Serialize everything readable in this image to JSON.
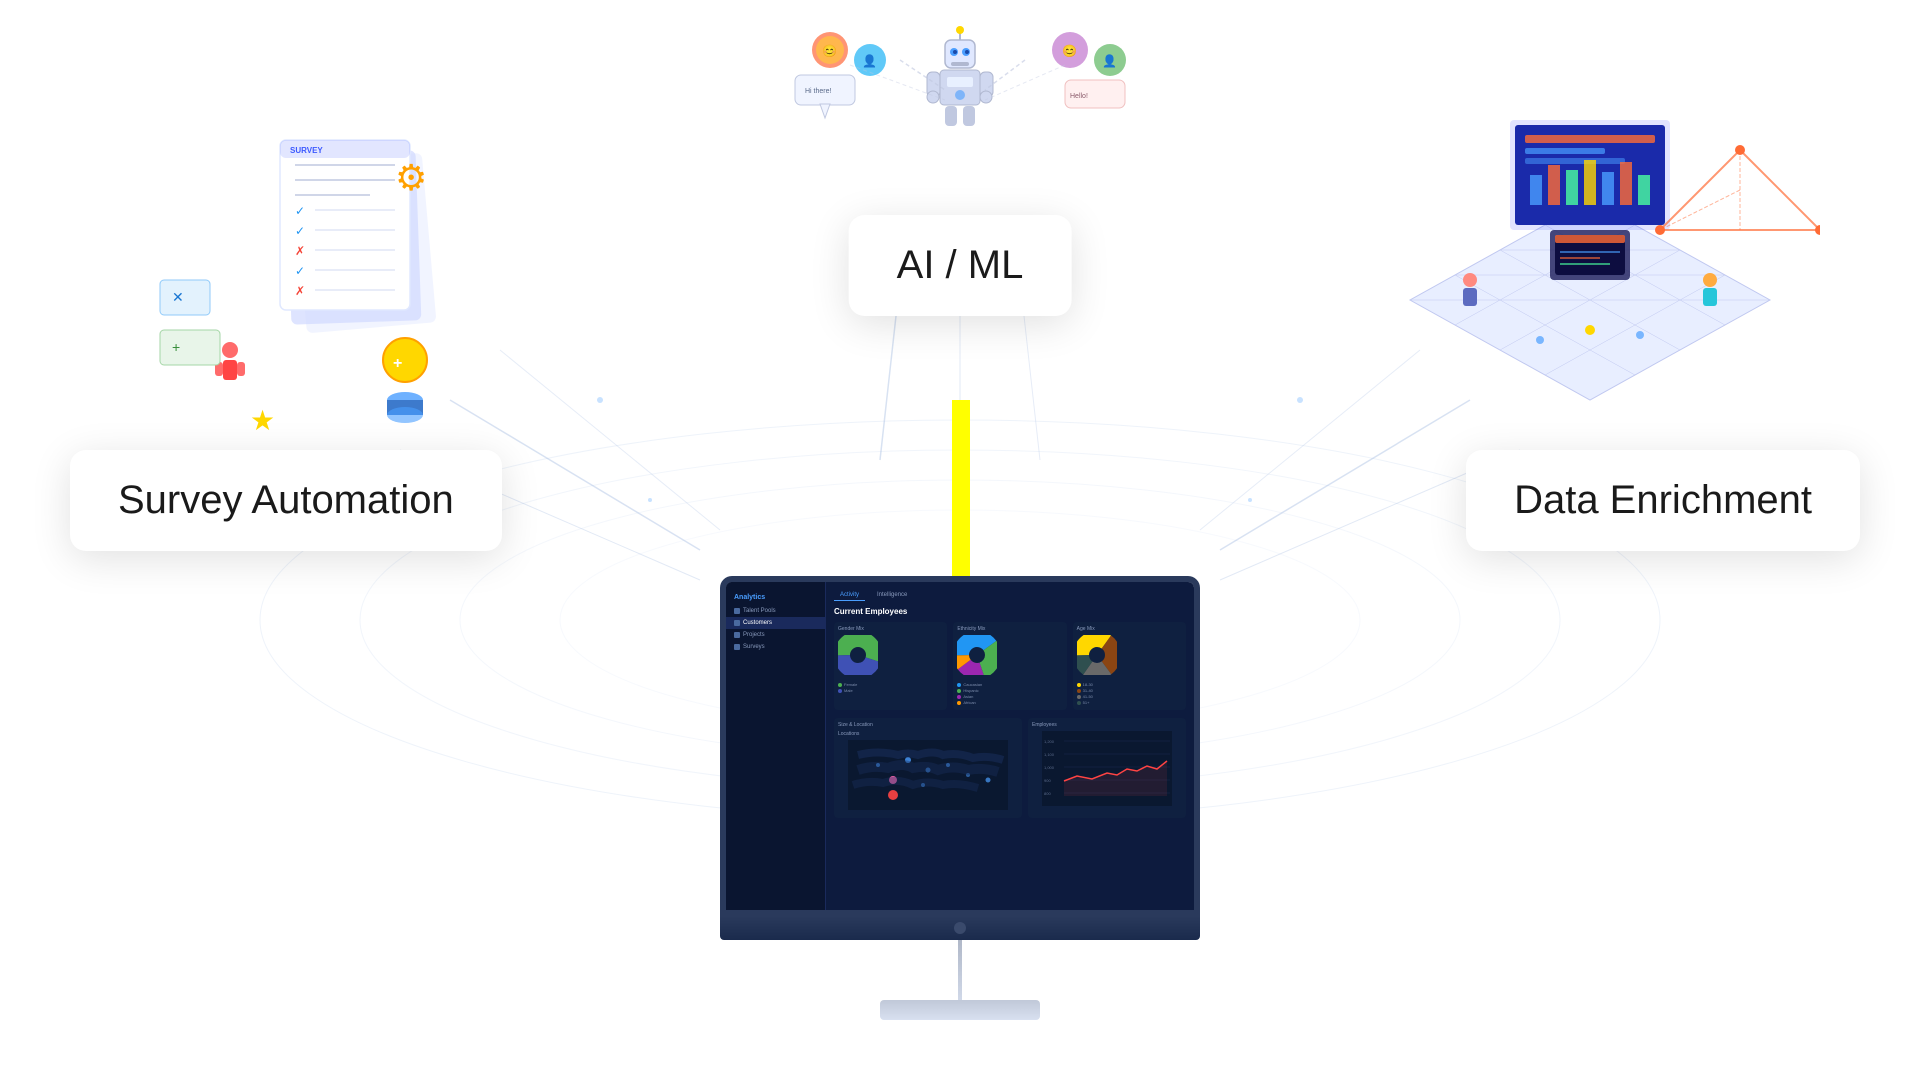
{
  "labels": {
    "survey_automation": "Survey Automation",
    "ai_ml": "AI / ML",
    "data_enrichment": "Data Enrichment"
  },
  "dashboard": {
    "app_title": "Analytics",
    "tabs": [
      "Activity",
      "Intelligence"
    ],
    "section_title": "Current Employees",
    "sidebar_items": [
      {
        "label": "Talent Pools"
      },
      {
        "label": "Customers"
      },
      {
        "label": "Projects"
      },
      {
        "label": "Surveys"
      }
    ],
    "charts": [
      {
        "label": "Gender Mix",
        "segments": [
          {
            "color": "#4caf50",
            "value": 55
          },
          {
            "color": "#3f51b5",
            "value": 45
          }
        ]
      },
      {
        "label": "Ethnicity Mix",
        "segments": [
          {
            "color": "#2196f3",
            "value": 40
          },
          {
            "color": "#4caf50",
            "value": 30
          },
          {
            "color": "#9c27b0",
            "value": 20
          },
          {
            "color": "#ff9800",
            "value": 10
          }
        ]
      },
      {
        "label": "Age Mix",
        "segments": [
          {
            "color": "#ffd700",
            "value": 35
          },
          {
            "color": "#8b4513",
            "value": 30
          },
          {
            "color": "#696969",
            "value": 20
          },
          {
            "color": "#2f4f4f",
            "value": 15
          }
        ]
      }
    ],
    "bottom_sections": [
      {
        "label": "Size & Location"
      },
      {
        "label": "Employees"
      }
    ]
  },
  "colors": {
    "bg": "#ffffff",
    "monitor_bg": "#0d1b3e",
    "card_bg": "#ffffff",
    "accent_blue": "#4a9eff",
    "accent_yellow": "#ffff00",
    "text_dark": "#1a1a1a"
  }
}
